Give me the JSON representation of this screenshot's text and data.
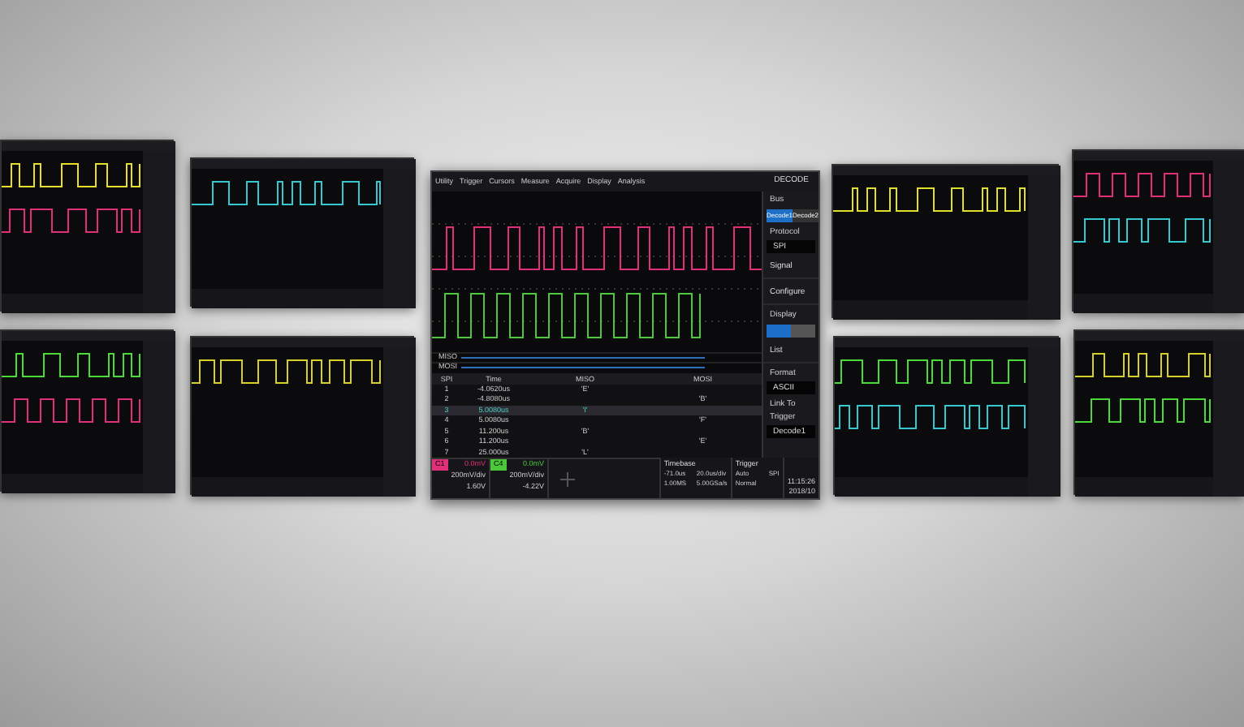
{
  "scope": {
    "menu": [
      "Utility",
      "Trigger",
      "Cursors",
      "Measure",
      "Acquire",
      "Display",
      "Analysis"
    ],
    "panel_title": "DECODE",
    "sidebar": [
      {
        "kind": "label",
        "text": "Bus"
      },
      {
        "kind": "toggle",
        "options": [
          {
            "label": "Decode1",
            "selected": true
          },
          {
            "label": "Decode2",
            "selected": false
          }
        ]
      },
      {
        "kind": "label",
        "text": "Protocol"
      },
      {
        "kind": "select",
        "value": "SPI"
      },
      {
        "kind": "row",
        "text": "Signal"
      },
      {
        "kind": "row",
        "text": "Configure"
      },
      {
        "kind": "label",
        "text": "Display"
      },
      {
        "kind": "switch",
        "on": true
      },
      {
        "kind": "row",
        "text": "List"
      },
      {
        "kind": "label",
        "text": "Format"
      },
      {
        "kind": "select",
        "value": "ASCII"
      },
      {
        "kind": "label",
        "text": "Link To Trigger"
      },
      {
        "kind": "select",
        "value": "Decode1"
      }
    ],
    "bus_rows": [
      "MISO",
      "MOSI"
    ],
    "table": {
      "columns": [
        "SPI",
        "Time",
        "MISO",
        "MOSI"
      ],
      "rows": [
        {
          "cells": [
            "1",
            "-4.0620us",
            "'E'",
            ""
          ],
          "selected": false
        },
        {
          "cells": [
            "2",
            "-4.8080us",
            "",
            "'B'"
          ],
          "selected": false
        },
        {
          "cells": [
            "3",
            "5.0080us",
            "'I'",
            ""
          ],
          "selected": true
        },
        {
          "cells": [
            "4",
            "5.0080us",
            "",
            "'F'"
          ],
          "selected": false
        },
        {
          "cells": [
            "5",
            "11.200us",
            "'B'",
            ""
          ],
          "selected": false
        },
        {
          "cells": [
            "6",
            "11.200us",
            "",
            "'E'"
          ],
          "selected": false
        },
        {
          "cells": [
            "7",
            "25.000us",
            "'L'",
            ""
          ],
          "selected": false
        }
      ]
    },
    "channels": [
      {
        "label": "C1",
        "color": "#e0307a",
        "offset": "0.0mV",
        "scale": "200mV/div",
        "value": "1.60V"
      },
      {
        "label": "C4",
        "color": "#4cc93a",
        "offset": "0.0mV",
        "scale": "200mV/div",
        "value": "-4.22V"
      }
    ],
    "timebase": {
      "title": "Timebase",
      "values": [
        "-71.0us",
        "20.0us/div",
        "1.00MS",
        "5.00GSa/s"
      ]
    },
    "trigger": {
      "title": "Trigger",
      "values": [
        "Auto",
        "SPI",
        "Normal"
      ]
    },
    "clock": [
      "11:15:26",
      "2018/10"
    ]
  }
}
